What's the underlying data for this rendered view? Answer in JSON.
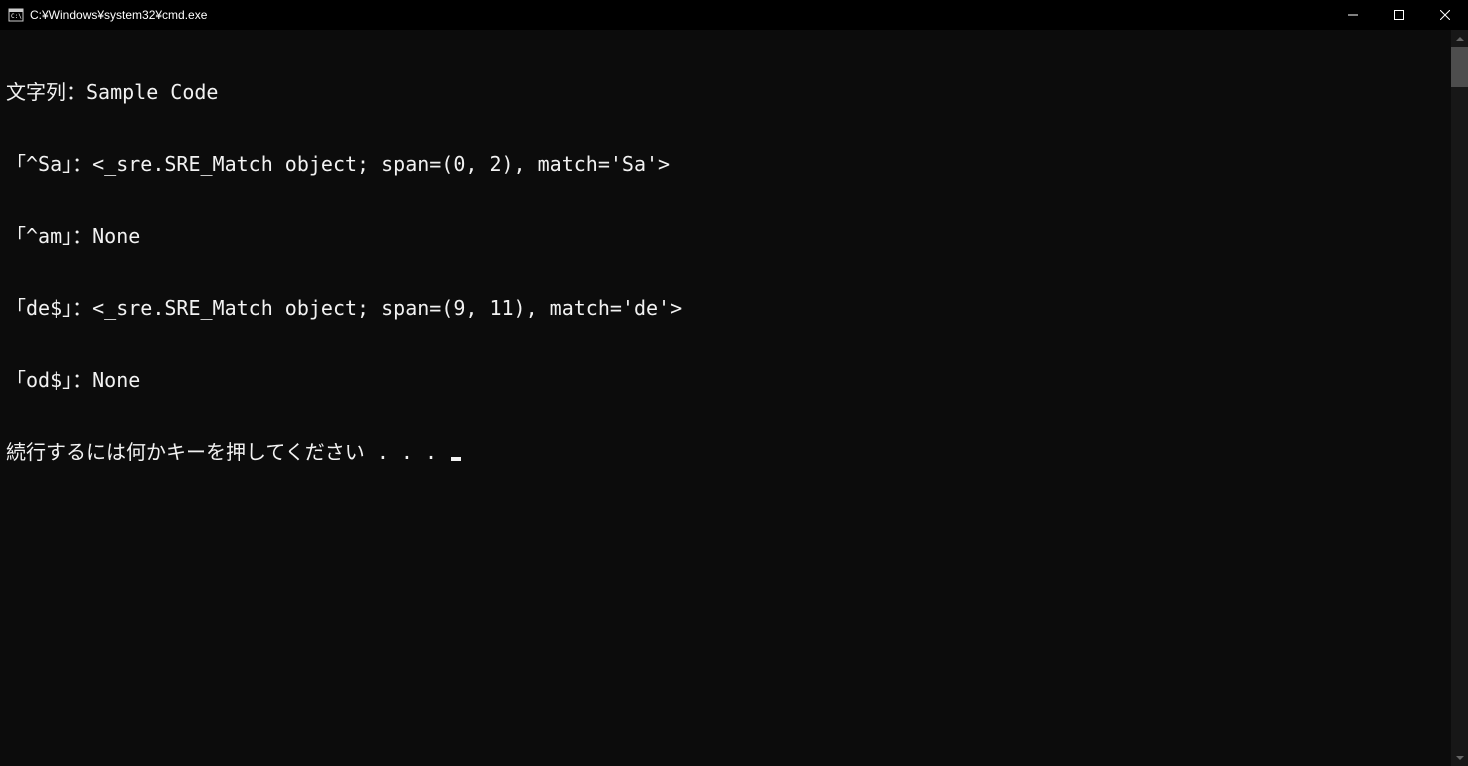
{
  "window": {
    "title": "C:¥Windows¥system32¥cmd.exe"
  },
  "terminal": {
    "lines": [
      "文字列：Sample Code",
      "「^Sa」：<_sre.SRE_Match object; span=(0, 2), match='Sa'>",
      "「^am」：None",
      "「de$」：<_sre.SRE_Match object; span=(9, 11), match='de'>",
      "「od$」：None"
    ],
    "prompt_line": "続行するには何かキーを押してください . . . "
  }
}
